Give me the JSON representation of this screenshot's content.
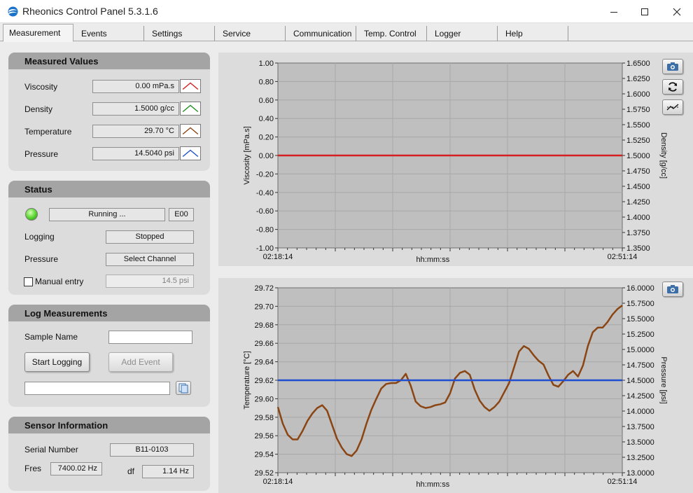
{
  "app": {
    "title": "Rheonics Control Panel 5.3.1.6"
  },
  "tabs": [
    "Measurement",
    "Events",
    "Settings",
    "Service",
    "Communication",
    "Temp. Control",
    "Logger",
    "Help"
  ],
  "measured": {
    "title": "Measured Values",
    "rows": [
      {
        "label": "Viscosity",
        "value": "0.00 mPa.s",
        "color": "#d42020"
      },
      {
        "label": "Density",
        "value": "1.5000 g/cc",
        "color": "#1f8f1f"
      },
      {
        "label": "Temperature",
        "value": "29.70 °C",
        "color": "#8b4513"
      },
      {
        "label": "Pressure",
        "value": "14.5040 psi",
        "color": "#1f4fd0"
      }
    ]
  },
  "status": {
    "title": "Status",
    "state": "Running ...",
    "code": "E00",
    "logging_label": "Logging",
    "logging_value": "Stopped",
    "pressure_label": "Pressure",
    "pressure_button": "Select Channel",
    "manual_label": "Manual entry",
    "manual_value": "14.5 psi"
  },
  "log": {
    "title": "Log Measurements",
    "sample_label": "Sample Name",
    "sample_value": "",
    "start_button": "Start Logging",
    "event_button": "Add Event",
    "path_value": ""
  },
  "sensor": {
    "title": "Sensor Information",
    "serial_label": "Serial Number",
    "serial_value": "B11-0103",
    "fres_label": "Fres",
    "fres_value": "7400.02 Hz",
    "df_label": "df",
    "df_value": "1.14 Hz"
  },
  "colors": {
    "viscosity": "#d42020",
    "density": "#1f8f1f",
    "temperature": "#8b4513",
    "pressure": "#1f4fd0"
  },
  "chart_data": [
    {
      "type": "line",
      "xlabel": "hh:mm:ss",
      "x_range": [
        "02:18:14",
        "02:51:14"
      ],
      "ylabel": "Viscosity [mPa.s]",
      "ylim": [
        -1.0,
        1.0
      ],
      "yticks": [
        "1.00",
        "0.80",
        "0.60",
        "0.40",
        "0.20",
        "0.00",
        "-0.20",
        "-0.40",
        "-0.60",
        "-0.80",
        "-1.00"
      ],
      "y2label": "Density [g/cc]",
      "y2lim": [
        1.35,
        1.65
      ],
      "y2ticks": [
        "1.6500",
        "1.6250",
        "1.6000",
        "1.5750",
        "1.5500",
        "1.5250",
        "1.5000",
        "1.4750",
        "1.4500",
        "1.4250",
        "1.4000",
        "1.3750",
        "1.3500"
      ],
      "grid": true,
      "series": [
        {
          "name": "Viscosity",
          "axis": "left",
          "color": "#d42020",
          "values": [
            0.0,
            0.0
          ]
        }
      ]
    },
    {
      "type": "line",
      "xlabel": "hh:mm:ss",
      "x_range": [
        "02:18:14",
        "02:51:14"
      ],
      "ylabel": "Temperature [°C]",
      "ylim": [
        29.52,
        29.72
      ],
      "yticks": [
        "29.72",
        "29.70",
        "29.68",
        "29.66",
        "29.64",
        "29.62",
        "29.60",
        "29.58",
        "29.56",
        "29.54",
        "29.52"
      ],
      "y2label": "Pressure [psi]",
      "y2lim": [
        13.0,
        16.0
      ],
      "y2ticks": [
        "16.0000",
        "15.7500",
        "15.5000",
        "15.2500",
        "15.0000",
        "14.7500",
        "14.5000",
        "14.2500",
        "14.0000",
        "13.7500",
        "13.5000",
        "13.2500",
        "13.0000"
      ],
      "grid": true,
      "series": [
        {
          "name": "Temperature",
          "axis": "left",
          "color": "#8b4513",
          "values": [
            29.591,
            29.573,
            29.561,
            29.556,
            29.556,
            29.565,
            29.576,
            29.584,
            29.59,
            29.593,
            29.587,
            29.572,
            29.557,
            29.547,
            29.54,
            29.538,
            29.544,
            29.556,
            29.573,
            29.588,
            29.6,
            29.611,
            29.616,
            29.617,
            29.617,
            29.62,
            29.627,
            29.614,
            29.597,
            29.592,
            29.59,
            29.591,
            29.593,
            29.594,
            29.596,
            29.606,
            29.622,
            29.628,
            29.63,
            29.626,
            29.61,
            29.598,
            29.591,
            29.587,
            29.591,
            29.597,
            29.607,
            29.617,
            29.634,
            29.651,
            29.657,
            29.654,
            29.647,
            29.641,
            29.637,
            29.625,
            29.615,
            29.613,
            29.619,
            29.626,
            29.63,
            29.624,
            29.636,
            29.657,
            29.672,
            29.677,
            29.677,
            29.683,
            29.691,
            29.697,
            29.701
          ]
        },
        {
          "name": "Pressure",
          "axis": "right",
          "color": "#1f4fd0",
          "values": [
            14.5,
            14.5
          ]
        }
      ]
    }
  ]
}
